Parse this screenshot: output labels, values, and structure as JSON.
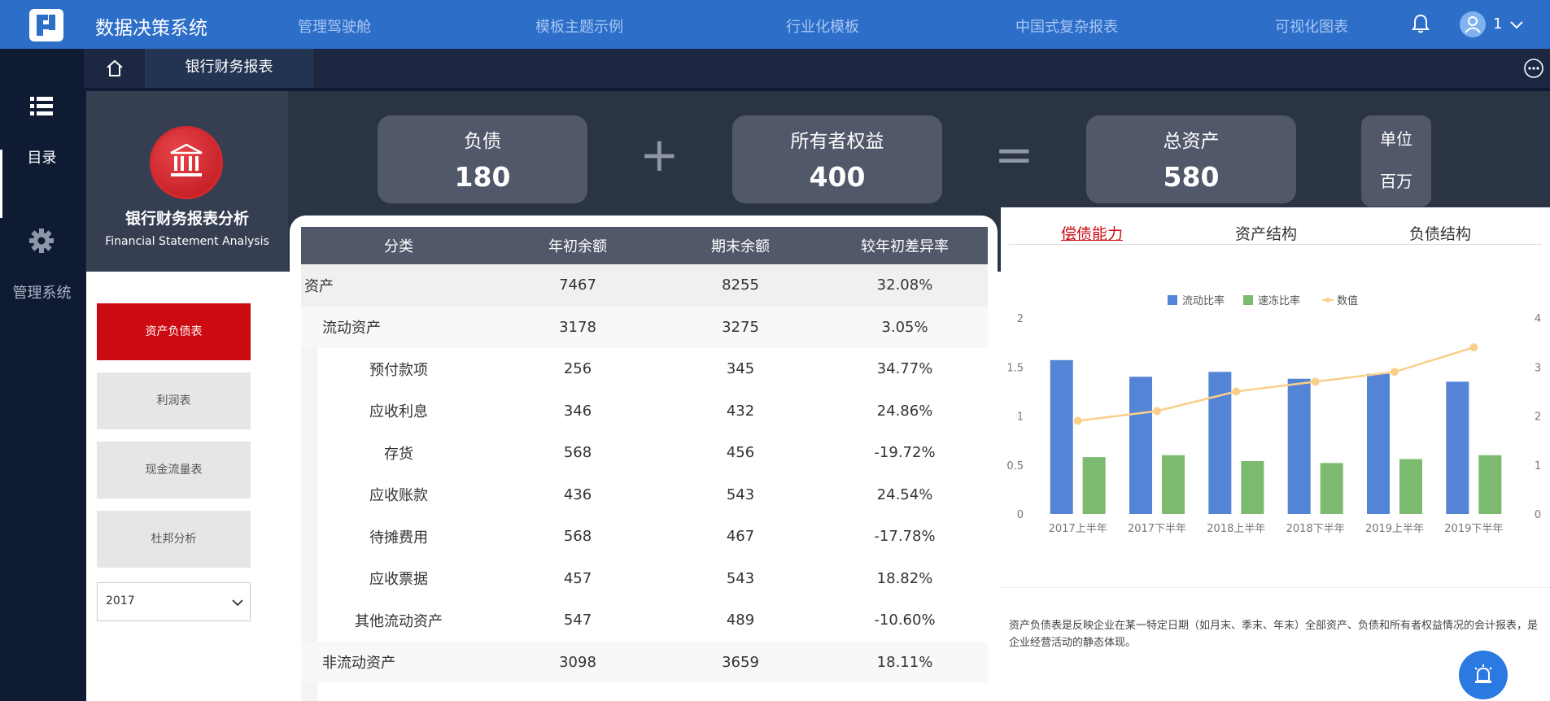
{
  "app": {
    "title": "数据决策系统"
  },
  "nav": [
    "管理驾驶舱",
    "模板主题示例",
    "行业化模板",
    "中国式复杂报表",
    "可视化图表"
  ],
  "user": {
    "name": "1"
  },
  "rail": {
    "menu_label": "目录",
    "admin_label": "管理系统"
  },
  "tabs": {
    "active": "银行财务报表"
  },
  "brand": {
    "title": "银行财务报表分析",
    "subtitle": "Financial Statement Analysis"
  },
  "kpis": [
    {
      "label": "负债",
      "value": "180"
    },
    {
      "label": "所有者权益",
      "value": "400"
    },
    {
      "label": "总资产",
      "value": "580"
    }
  ],
  "operators": {
    "plus": "+",
    "equals": "="
  },
  "unit": {
    "label": "单位",
    "value": "百万"
  },
  "side_menu": [
    "资产负债表",
    "利润表",
    "现金流量表",
    "杜邦分析"
  ],
  "year": "2017",
  "table": {
    "headers": [
      "分类",
      "年初余额",
      "期末余额",
      "较年初差异率"
    ],
    "rows": [
      {
        "cat": "资产",
        "start": "7467",
        "end": "8255",
        "diff": "32.08%"
      },
      {
        "cat": "流动资产",
        "start": "3178",
        "end": "3275",
        "diff": "3.05%"
      },
      {
        "cat": "预付款项",
        "start": "256",
        "end": "345",
        "diff": "34.77%"
      },
      {
        "cat": "应收利息",
        "start": "346",
        "end": "432",
        "diff": "24.86%"
      },
      {
        "cat": "存货",
        "start": "568",
        "end": "456",
        "diff": "-19.72%"
      },
      {
        "cat": "应收账款",
        "start": "436",
        "end": "543",
        "diff": "24.54%"
      },
      {
        "cat": "待摊费用",
        "start": "568",
        "end": "467",
        "diff": "-17.78%"
      },
      {
        "cat": "应收票据",
        "start": "457",
        "end": "543",
        "diff": "18.82%"
      },
      {
        "cat": "其他流动资产",
        "start": "547",
        "end": "489",
        "diff": "-10.60%"
      },
      {
        "cat": "非流动资产",
        "start": "3098",
        "end": "3659",
        "diff": "18.11%"
      }
    ]
  },
  "chart_tabs": [
    "偿债能力",
    "资产结构",
    "负债结构"
  ],
  "chart_data": {
    "type": "bar",
    "categories": [
      "2017上半年",
      "2017下半年",
      "2018上半年",
      "2018下半年",
      "2019上半年",
      "2019下半年"
    ],
    "series": [
      {
        "name": "流动比率",
        "type": "bar",
        "axis": "left",
        "color": "#5484d6",
        "values": [
          1.57,
          1.4,
          1.45,
          1.38,
          1.43,
          1.35
        ]
      },
      {
        "name": "速冻比率",
        "type": "bar",
        "axis": "left",
        "color": "#7cbb6f",
        "values": [
          0.58,
          0.6,
          0.54,
          0.52,
          0.56,
          0.6
        ]
      },
      {
        "name": "数值",
        "type": "line",
        "axis": "right",
        "color": "#f9cf8a",
        "values": [
          1.9,
          2.1,
          2.5,
          2.7,
          2.9,
          3.4
        ]
      }
    ],
    "ylim_left": [
      0,
      2
    ],
    "yticks_left": [
      "0",
      "0.5",
      "1",
      "1.5",
      "2"
    ],
    "ylim_right": [
      0,
      4
    ],
    "yticks_right": [
      "0",
      "1",
      "2",
      "3",
      "4"
    ],
    "legend_position": "top-center"
  },
  "description": "资产负债表是反映企业在某一特定日期（如月末、季末、年末）全部资产、负债和所有者权益情况的会计报表，是企业经营活动的静态体现。"
}
